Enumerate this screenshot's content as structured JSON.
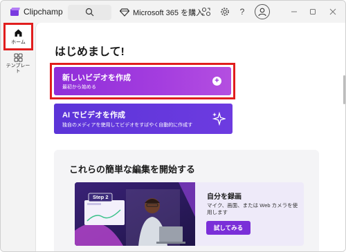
{
  "titlebar": {
    "app_title": "Clipchamp",
    "ms365_label": "Microsoft 365 を購入",
    "help_label": "?"
  },
  "sidebar": {
    "home_label": "ホーム",
    "templates_label": "テンプレート"
  },
  "main": {
    "heading": "はじめまして!",
    "create_video": {
      "title": "新しいビデオを作成",
      "subtitle": "最初から始める"
    },
    "ai_video": {
      "title": "AI でビデオを作成",
      "subtitle": "独自のメディアを使用してビデオをすばやく自動的に作成す"
    },
    "section": {
      "title": "これらの簡単な編集を開始する",
      "card": {
        "image_label": "Step 2",
        "title": "自分を録画",
        "description": "マイク、画面、または Web カメラを使用します",
        "button_label": "試してみる"
      }
    }
  },
  "colors": {
    "accent_purple": "#8f2ed9",
    "ai_blue_purple": "#5b34d8",
    "highlight_red": "#e11d1d"
  }
}
